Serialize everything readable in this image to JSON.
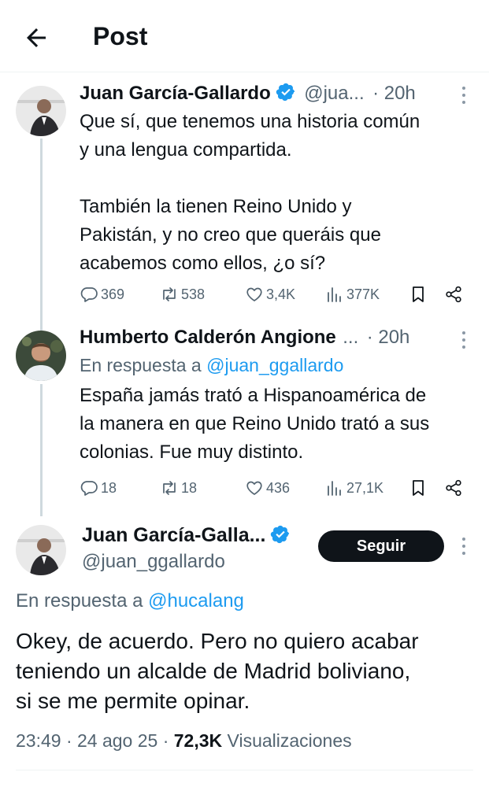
{
  "header": {
    "title": "Post"
  },
  "colors": {
    "link": "#1d9bf0",
    "verified": "#1d9bf0",
    "secondary_text": "#536471",
    "follow_button": "#0f1419"
  },
  "posts": [
    {
      "name": "Juan García-Gallardo",
      "handle": "@jua...",
      "time": "· 20h",
      "verified": true,
      "lines": [
        "Que sí, que tenemos una historia común",
        "y una lengua compartida.",
        "",
        "También la tienen Reino Unido y",
        "Pakistán, y no creo que queráis que",
        "acabemos como ellos, ¿o sí?"
      ],
      "stats": {
        "replies": "369",
        "reposts": "538",
        "likes": "3,4K",
        "views": "377K"
      }
    },
    {
      "name": "Humberto Calderón Angione",
      "name_ellipsis": "...",
      "time": "· 20h",
      "reply_prefix": "En respuesta a ",
      "reply_mention": "@juan_ggallardo",
      "lines": [
        "España jamás trató a Hispanoamérica de",
        "la manera en que Reino Unido trató a sus",
        "colonias. Fue muy distinto."
      ],
      "stats": {
        "replies": "18",
        "reposts": "18",
        "likes": "436",
        "views": "27,1K"
      }
    }
  ],
  "main_post": {
    "name": "Juan García-Galla...",
    "handle": "@juan_ggallardo",
    "follow_label": "Seguir",
    "reply_prefix": "En respuesta a ",
    "reply_mention": "@hucalang",
    "lines": [
      "Okey, de acuerdo. Pero no quiero acabar",
      "teniendo un alcalde de Madrid boliviano,",
      "si se me permite opinar."
    ],
    "timestamp": "23:49 · 24 ago 25 · ",
    "views_count": "72,3K",
    "views_label": " Visualizaciones"
  }
}
